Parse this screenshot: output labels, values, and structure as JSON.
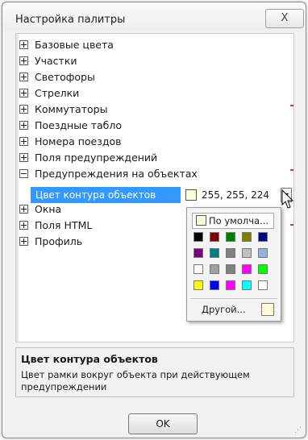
{
  "window": {
    "title": "Настройка палитры",
    "close_label": "X"
  },
  "tree": {
    "items": [
      {
        "label": "Базовые цвета",
        "state": "collapsed"
      },
      {
        "label": "Участки",
        "state": "collapsed"
      },
      {
        "label": "Светофоры",
        "state": "collapsed"
      },
      {
        "label": "Стрелки",
        "state": "collapsed"
      },
      {
        "label": "Коммутаторы",
        "state": "collapsed"
      },
      {
        "label": "Поездные табло",
        "state": "collapsed"
      },
      {
        "label": "Номера поездов",
        "state": "collapsed"
      },
      {
        "label": "Поля предупреждений",
        "state": "collapsed"
      },
      {
        "label": "Предупреждения на объектах",
        "state": "expanded"
      },
      {
        "label": "Окна",
        "state": "collapsed"
      },
      {
        "label": "Поля HTML",
        "state": "collapsed"
      },
      {
        "label": "Профиль",
        "state": "collapsed"
      }
    ],
    "property": {
      "label": "Цвет контура объектов",
      "value": "255, 255, 224",
      "swatch_color": "#ffffe0"
    }
  },
  "color_popup": {
    "default_label": "По умолча...",
    "other_label": "Другой...",
    "other_swatch": "#ffffe0",
    "colors": [
      "#000000",
      "#800000",
      "#008000",
      "#808000",
      "#000080",
      "#800080",
      "#008080",
      "#808080",
      "#c0c0c0",
      "#8fb4d9",
      "#ffffff",
      "#a0a0a0",
      "#808080",
      "#ff00ff",
      "#00ff00",
      "#ffff00",
      "#0000ff",
      "#ff00ff",
      "#00ffff",
      "#ffffff"
    ]
  },
  "description": {
    "title": "Цвет контура объектов",
    "text": "Цвет рамки вокруг объекта при действующем предупреждении"
  },
  "buttons": {
    "ok_label": "OK"
  },
  "colors": {
    "selection": "#3399ff",
    "accent_red": "#d23a3a"
  }
}
